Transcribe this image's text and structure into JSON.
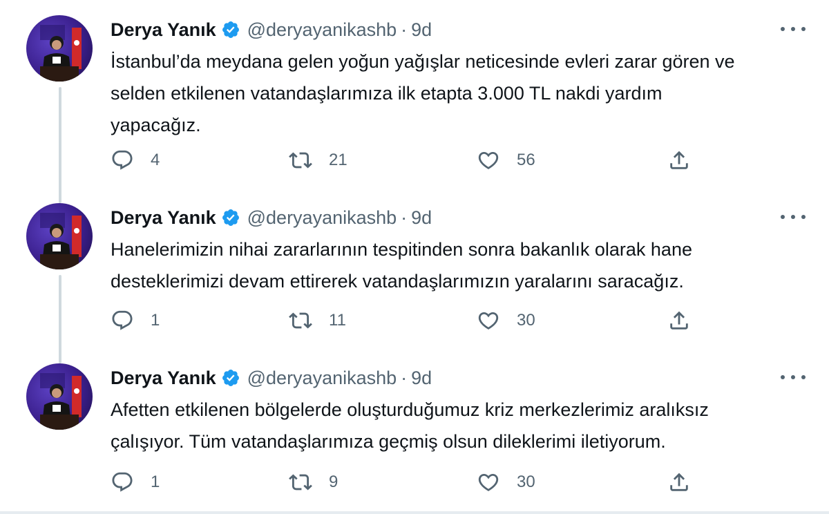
{
  "tweets": [
    {
      "author": "Derya Yanık",
      "handle": "@deryayanikashb",
      "separator": "·",
      "time": "9d",
      "lines": [
        "İstanbul’da meydana gelen yoğun yağışlar neticesinde evleri zarar gören ve",
        "selden etkilenen vatandaşlarımıza  ilk etapta 3.000 TL nakdi yardım",
        "yapacağız."
      ],
      "replies": "4",
      "retweets": "21",
      "likes": "56"
    },
    {
      "author": "Derya Yanık",
      "handle": "@deryayanikashb",
      "separator": "·",
      "time": "9d",
      "lines": [
        "Hanelerimizin nihai zararlarının tespitinden sonra bakanlık olarak hane",
        "desteklerimizi devam ettirerek vatandaşlarımızın yaralarını saracağız."
      ],
      "replies": "1",
      "retweets": "11",
      "likes": "30"
    },
    {
      "author": "Derya Yanık",
      "handle": "@deryayanikashb",
      "separator": "·",
      "time": "9d",
      "lines": [
        "Afetten etkilenen bölgelerde oluşturduğumuz kriz merkezlerimiz aralıksız",
        "çalışıyor. Tüm vatandaşlarımıza geçmiş olsun dileklerimi iletiyorum."
      ],
      "replies": "1",
      "retweets": "9",
      "likes": "30"
    }
  ],
  "icons": {
    "verified": "verified-badge-icon",
    "reply": "reply-icon",
    "retweet": "retweet-icon",
    "like": "heart-icon",
    "share": "share-icon",
    "more": "more-options-icon"
  },
  "colors": {
    "verified": "#1d9bf0",
    "text": "#0f1419",
    "muted": "#536471",
    "thread_line": "#cfd9de"
  }
}
